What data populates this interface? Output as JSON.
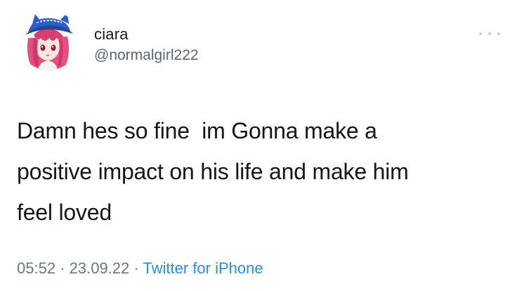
{
  "user": {
    "display_name": "ciara",
    "handle": "@normalgirl222",
    "avatar_icon": "anime-girl-avatar"
  },
  "more_icon": "more-options-icon",
  "tweet": {
    "text": "Damn hes so fine  im Gonna make a\npositive impact on his life and make him\nfeel loved"
  },
  "meta": {
    "time": "05:52",
    "separator1": " · ",
    "date": "23.09.22",
    "separator2": " · ",
    "source": "Twitter for iPhone"
  },
  "colors": {
    "text": "#14171a",
    "secondary": "#657786",
    "link": "#2b8fd6",
    "avatar_hat": "#2f5fc4",
    "avatar_hair": "#e4507f"
  }
}
